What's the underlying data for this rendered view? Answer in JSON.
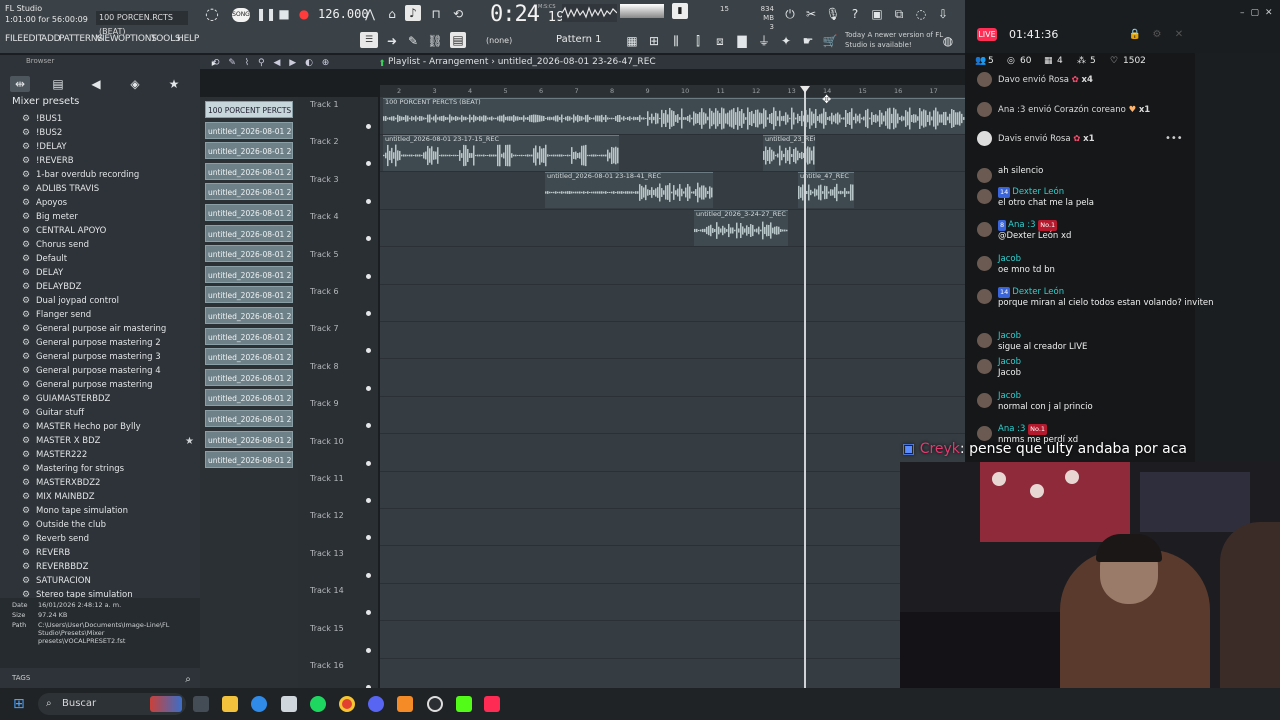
{
  "app": {
    "title": "FL Studio",
    "time_info": "1:01:00 for 56:00:09",
    "song_name": "100 PORCEN.RCTS (BEAT)",
    "bpm": "126.000",
    "clock": "0:24",
    "clock_sub": "19",
    "mcs": "M:S:CS",
    "cpu": "15",
    "mem": "834 MB",
    "mem_sub": "3",
    "pattern": "Pattern 1",
    "none": "(none)",
    "news": "Today  A newer version of FL Studio is available!",
    "menus": [
      "FILE",
      "EDIT",
      "ADD",
      "PATTERNS",
      "VIEW",
      "OPTIONS",
      "TOOLS",
      "HELP"
    ]
  },
  "browser": {
    "header": "Browser",
    "folder": "Mixer presets",
    "presets": [
      "!BUS1",
      "!BUS2",
      "!DELAY",
      "!REVERB",
      "1-bar overdub recording",
      "ADLIBS TRAVIS",
      "Apoyos",
      "Big meter",
      "CENTRAL APOYO",
      "Chorus send",
      "Default",
      "DELAY",
      "DELAYBDZ",
      "Dual joypad control",
      "Flanger send",
      "General purpose air mastering",
      "General purpose mastering 2",
      "General purpose mastering 3",
      "General purpose mastering 4",
      "General purpose mastering",
      "GUIAMASTERBDZ",
      "Guitar stuff",
      "MASTER Hecho por Bylly",
      "MASTER X BDZ",
      "MASTER222",
      "Mastering for strings",
      "MASTERXBDZ2",
      "MIX MAINBDZ",
      "Mono tape simulation",
      "Outside the club",
      "Reverb send",
      "REVERB",
      "REVERBBDZ",
      "SATURACION",
      "Stereo tape simulation"
    ],
    "info": {
      "date_label": "Date",
      "date": "16/01/2026 2:48:12 a. m.",
      "size_label": "Size",
      "size": "97.24 KB",
      "path_label": "Path",
      "path": "C:\\Users\\User\\Documents\\Image-Line\\FL Studio\\Presets\\Mixer presets\\VOCALPRESET2.fst"
    },
    "tags": "TAGS"
  },
  "playlist": {
    "title": "Playlist - Arrangement",
    "file": "untitled_2026-08-01 23-26-47_REC",
    "clips": [
      "100 PORCENT PERCTS..",
      "untitled_2026-08-01 23-..",
      "untitled_2026-08-01 23-..",
      "untitled_2026-08-01 23-..",
      "untitled_2026-08-01 23-..",
      "untitled_2026-08-01 23-..",
      "untitled_2026-08-01 23-..",
      "untitled_2026-08-01 23-..",
      "untitled_2026-08-01 23-..",
      "untitled_2026-08-01 23-..",
      "untitled_2026-08-01 23-..",
      "untitled_2026-08-01 23-..",
      "untitled_2026-08-01 23-..",
      "untitled_2026-08-01 23-..",
      "untitled_2026-08-01 23-..",
      "untitled_2026-08-01 23-..",
      "untitled_2026-08-01 23-..",
      "untitled_2026-08-01 23-.."
    ],
    "tracks": [
      "Track 1",
      "Track 2",
      "Track 3",
      "Track 4",
      "Track 5",
      "Track 6",
      "Track 7",
      "Track 8",
      "Track 9",
      "Track 10",
      "Track 11",
      "Track 12",
      "Track 13",
      "Track 14",
      "Track 15",
      "Track 16"
    ],
    "ruler": [
      "2",
      "3",
      "4",
      "5",
      "6",
      "7",
      "8",
      "9",
      "10",
      "11",
      "12",
      "13",
      "14",
      "15",
      "16",
      "17"
    ],
    "audio": {
      "a1": "100 PORCENT PERCTS (BEAT)",
      "a2": "untitled_2026-08-01 23-17-15_REC",
      "a3": "untitled_23_REC",
      "a4": "untitled_2026-08-01 23-18-41_REC",
      "a5": "untitle_47_REC",
      "a6": "untitled_2026_3-24-27_REC"
    }
  },
  "stream": {
    "live": "LIVE",
    "time": "01:41:36",
    "stats": [
      "5",
      "60",
      "4",
      "5",
      "1502"
    ],
    "gifts": [
      {
        "text": "Davo envió Rosa",
        "mult": "x4"
      },
      {
        "text": "Ana :3 envió Corazón coreano",
        "mult": "x1"
      },
      {
        "text": "Davis envió Rosa",
        "mult": "x1"
      }
    ],
    "messages": [
      {
        "user": "",
        "badge": "",
        "text": "ah silencio"
      },
      {
        "user": "Dexter León",
        "badge": "14",
        "text": "el otro chat me la pela"
      },
      {
        "user": "Ana :3",
        "badge": "8",
        "rank": "No.1",
        "text": "@Dexter León  xd"
      },
      {
        "user": "Jacob",
        "badge": "",
        "text": "oe mno td bn"
      },
      {
        "user": "Dexter León",
        "badge": "14",
        "text": "porque miran al cielo todos estan volando? inviten"
      },
      {
        "user": "Jacob",
        "badge": "",
        "text": "sigue al creador LIVE"
      },
      {
        "user": "Jacob",
        "badge": "",
        "text": "Jacob"
      },
      {
        "user": "Jacob",
        "badge": "",
        "text": "normal con j al princio"
      },
      {
        "user": "Ana :3",
        "badge": "",
        "rank": "No.1",
        "text": "nmms me perdí xd"
      }
    ],
    "caption_user": "Creyk",
    "caption_text": ": pense que ulty andaba por aca"
  },
  "taskbar": {
    "search": "Buscar"
  }
}
